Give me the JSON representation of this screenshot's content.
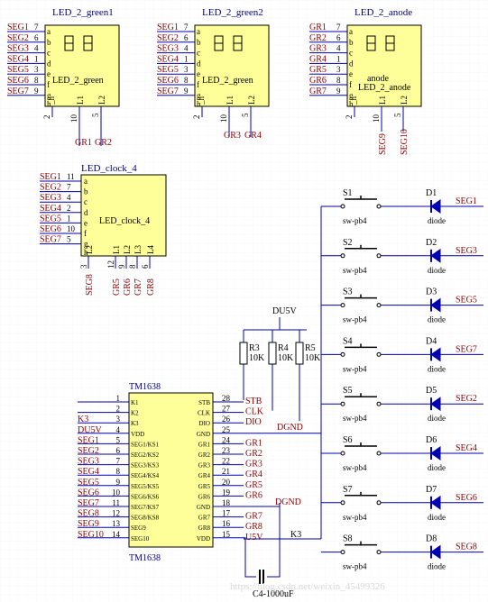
{
  "colors": {
    "wire": "#0000b0",
    "body": "#ffff99",
    "net": "#8b0000",
    "pin": "#000000",
    "ref": "#00007a"
  },
  "led_green1": {
    "title": "LED_2_green1",
    "label": "LED_2_green"
  },
  "led_green2": {
    "title": "LED_2_green2",
    "label": "LED_2_green"
  },
  "led_anode": {
    "title": "LED_2_anode",
    "label1": "anode",
    "label2": "LED_2_anode"
  },
  "led_clock": {
    "title": "LED_clock_4",
    "label": "LED_clock_4"
  },
  "seg_pins": [
    {
      "letter": "a",
      "pin": "7"
    },
    {
      "letter": "b",
      "pin": "6"
    },
    {
      "letter": "c",
      "pin": "4"
    },
    {
      "letter": "d",
      "pin": "1"
    },
    {
      "letter": "e",
      "pin": "3"
    },
    {
      "letter": "f",
      "pin": "8"
    },
    {
      "letter": "g",
      "pin": "9"
    },
    {
      "letter": "h",
      "pin": "2"
    }
  ],
  "clock_pins": [
    "11",
    "7",
    "4",
    "2",
    "1",
    "10",
    "5",
    "3"
  ],
  "seg_nets": [
    "SEG1",
    "SEG2",
    "SEG3",
    "SEG4",
    "SEG5",
    "SEG6",
    "SEG7"
  ],
  "gr_nets": [
    "GR1",
    "GR2",
    "GR3",
    "GR4",
    "GR5",
    "GR6",
    "GR7"
  ],
  "bottom_pins": {
    "l1": "10",
    "l2": "5",
    "l1_label": "L1",
    "l2_label": "L2",
    "h": "2",
    "h_label": "_h"
  },
  "bottom_nets": {
    "g1a": "GR1",
    "g1b": "GR2",
    "g2a": "GR3",
    "g2b": "GR4",
    "a_a": "SEG9",
    "a_b": "SEG10"
  },
  "clock_bottom": {
    "pins": [
      "3",
      "12",
      "9",
      "8",
      "6"
    ],
    "labels": [
      "L2",
      "L1",
      "L2",
      "L3",
      "L4"
    ],
    "nets": [
      "SEG8",
      "GR5",
      "GR6",
      "GR7",
      "GR8"
    ]
  },
  "ic": {
    "name": "TM1638",
    "left_pins": [
      {
        "no": "1",
        "name": "K1",
        "net": ""
      },
      {
        "no": "2",
        "name": "K2",
        "net": ""
      },
      {
        "no": "3",
        "name": "K3",
        "net": "K3"
      },
      {
        "no": "4",
        "name": "VDD",
        "net": "DU5V"
      },
      {
        "no": "5",
        "name": "SEG1/KS1",
        "net": "SEG1"
      },
      {
        "no": "6",
        "name": "SEG2/KS2",
        "net": "SEG2"
      },
      {
        "no": "7",
        "name": "SEG3/KS3",
        "net": "SEG3"
      },
      {
        "no": "8",
        "name": "SEG4/KS4",
        "net": "SEG4"
      },
      {
        "no": "9",
        "name": "SEG5/KS5",
        "net": "SEG5"
      },
      {
        "no": "10",
        "name": "SEG6/KS6",
        "net": "SEG6"
      },
      {
        "no": "11",
        "name": "SEG7/KS7",
        "net": "SEG7"
      },
      {
        "no": "12",
        "name": "SEG8/KS8",
        "net": "SEG8"
      },
      {
        "no": "13",
        "name": "SEG9",
        "net": "SEG9"
      },
      {
        "no": "14",
        "name": "SEG10",
        "net": "SEG10"
      }
    ],
    "right_pins": [
      {
        "no": "28",
        "name": "STB",
        "net": "STB"
      },
      {
        "no": "27",
        "name": "CLK",
        "net": "CLK"
      },
      {
        "no": "26",
        "name": "DIO",
        "net": "DIO"
      },
      {
        "no": "25",
        "name": "GND",
        "net": ""
      },
      {
        "no": "24",
        "name": "GR1",
        "net": "GR1"
      },
      {
        "no": "23",
        "name": "GR2",
        "net": "GR2"
      },
      {
        "no": "22",
        "name": "GR3",
        "net": "GR3"
      },
      {
        "no": "21",
        "name": "GR4",
        "net": "GR4"
      },
      {
        "no": "20",
        "name": "GR5",
        "net": "GR5"
      },
      {
        "no": "19",
        "name": "GR6",
        "net": "GR6"
      },
      {
        "no": "18",
        "name": "GND",
        "net": ""
      },
      {
        "no": "17",
        "name": "GR7",
        "net": "GR7"
      },
      {
        "no": "16",
        "name": "GR8",
        "net": "GR8"
      },
      {
        "no": "15",
        "name": "VDD",
        "net": "U5V"
      }
    ]
  },
  "power": {
    "du5v": "DU5V",
    "dgnd1": "DGND",
    "dgnd2": "DGND",
    "k3": "K3"
  },
  "resistors": [
    {
      "ref": "R3",
      "val": "10K"
    },
    {
      "ref": "R4",
      "val": "10K"
    },
    {
      "ref": "R5",
      "val": "10K"
    }
  ],
  "cap": {
    "label": "C4-1000uF"
  },
  "switches": [
    {
      "ref": "S1",
      "type": "sw-pb4",
      "diode": "D1",
      "dtype": "diode",
      "net": "SEG1"
    },
    {
      "ref": "S2",
      "type": "sw-pb4",
      "diode": "D2",
      "dtype": "diode",
      "net": "SEG3"
    },
    {
      "ref": "S3",
      "type": "sw-pb4",
      "diode": "D3",
      "dtype": "diode",
      "net": "SEG5"
    },
    {
      "ref": "S4",
      "type": "sw-pb4",
      "diode": "D4",
      "dtype": "diode",
      "net": "SEG7"
    },
    {
      "ref": "S5",
      "type": "sw-pb4",
      "diode": "D5",
      "dtype": "diode",
      "net": "SEG2"
    },
    {
      "ref": "S6",
      "type": "sw-pb4",
      "diode": "D6",
      "dtype": "diode",
      "net": "SEG4"
    },
    {
      "ref": "S7",
      "type": "sw-pb4",
      "diode": "D7",
      "dtype": "diode",
      "net": "SEG6"
    },
    {
      "ref": "S8",
      "type": "sw-pb4",
      "diode": "D8",
      "dtype": "diode",
      "net": "SEG8"
    }
  ],
  "watermark": "https://blog.csdn.net/weixin_45499326"
}
